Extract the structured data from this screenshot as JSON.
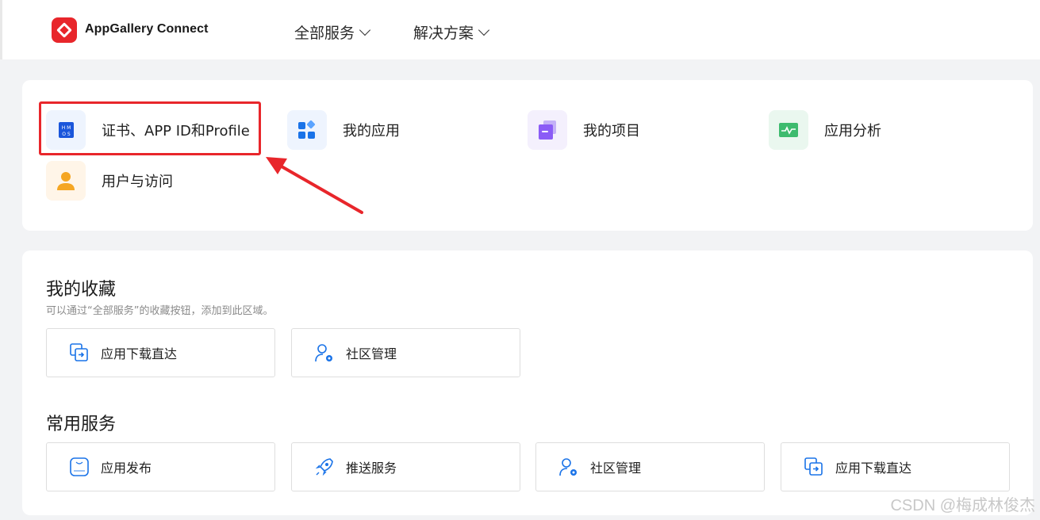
{
  "header": {
    "brand": "AppGallery Connect",
    "nav": [
      {
        "label": "全部服务"
      },
      {
        "label": "解决方案"
      }
    ]
  },
  "quick_access": [
    {
      "label": "证书、APP ID和Profile",
      "icon": "hmos-icon",
      "highlighted": true
    },
    {
      "label": "我的应用",
      "icon": "apps-grid-icon"
    },
    {
      "label": "我的项目",
      "icon": "project-stack-icon"
    },
    {
      "label": "应用分析",
      "icon": "analytics-chart-icon"
    },
    {
      "label": "用户与访问",
      "icon": "user-icon"
    }
  ],
  "favorites": {
    "title": "我的收藏",
    "subtitle": "可以通过“全部服务”的收藏按钮，添加到此区域。",
    "items": [
      {
        "label": "应用下载直达",
        "icon": "download-direct-icon"
      },
      {
        "label": "社区管理",
        "icon": "community-manage-icon"
      }
    ]
  },
  "common": {
    "title": "常用服务",
    "items": [
      {
        "label": "应用发布",
        "icon": "app-release-icon"
      },
      {
        "label": "推送服务",
        "icon": "rocket-icon"
      },
      {
        "label": "社区管理",
        "icon": "community-manage-icon"
      },
      {
        "label": "应用下载直达",
        "icon": "download-direct-icon"
      }
    ]
  },
  "watermark": "CSDN @梅成林俊杰",
  "colors": {
    "accent_red": "#e8262b",
    "blue": "#1a73e8",
    "purple": "#8b5cf6",
    "green": "#3dbb6e",
    "orange": "#f5a623"
  }
}
